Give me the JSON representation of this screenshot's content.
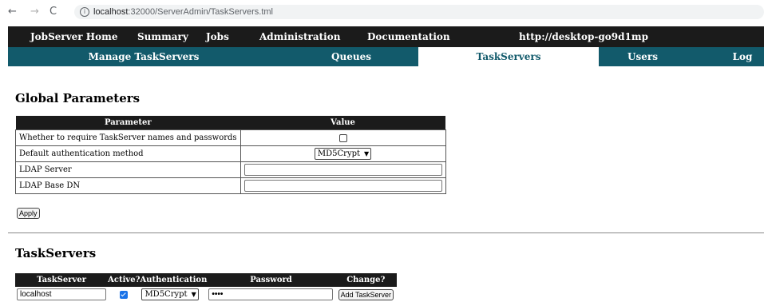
{
  "browser": {
    "back": "←",
    "forward": "→",
    "reload": "C",
    "info": "i",
    "url_host": "localhost",
    "url_rest": ":32000/ServerAdmin/TaskServers.tml"
  },
  "topnav": [
    "JobServer Home",
    "Summary",
    "Jobs",
    "Administration",
    "Documentation",
    "http://desktop-go9d1mp"
  ],
  "subnav": [
    "Manage TaskServers",
    "Queues",
    "TaskServers",
    "Users",
    "Log"
  ],
  "global": {
    "title": "Global Parameters",
    "col_parameter": "Parameter",
    "col_value": "Value",
    "rows": [
      {
        "label": "Whether to require TaskServer names and passwords",
        "checked": false
      },
      {
        "label": "Default authentication method",
        "value": "MD5Crypt"
      },
      {
        "label": "LDAP Server",
        "value": ""
      },
      {
        "label": "LDAP Base DN",
        "value": ""
      }
    ],
    "apply": "Apply"
  },
  "taskservers": {
    "title": "TaskServers",
    "cols": [
      "TaskServer",
      "Active?",
      "Authentication",
      "Password",
      "Change?"
    ],
    "row": {
      "name": "localhost",
      "active": true,
      "auth": "MD5Crypt",
      "password": "••••",
      "action": "Add TaskServer"
    }
  }
}
